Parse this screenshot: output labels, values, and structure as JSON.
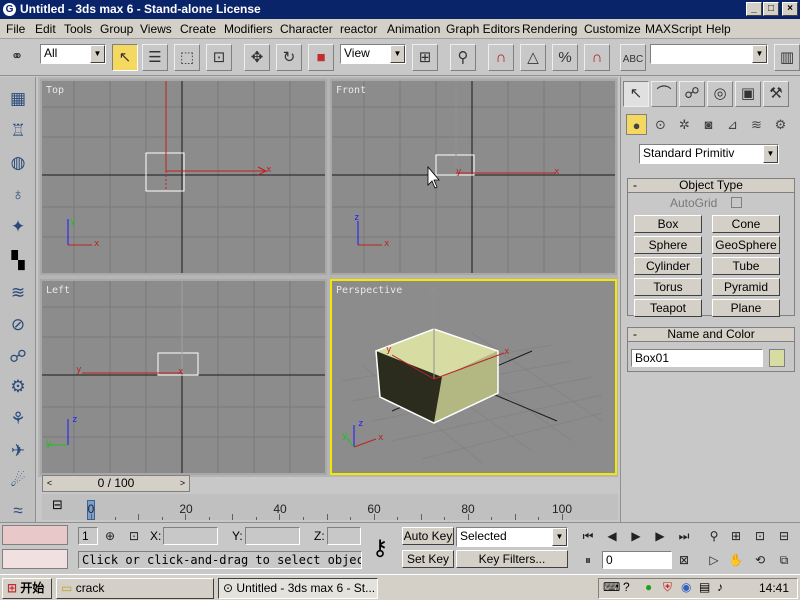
{
  "window": {
    "title": "Untitled - 3ds max 6 - Stand-alone License",
    "app_icon": "G",
    "controls": [
      "_",
      "□",
      "×"
    ]
  },
  "menu": [
    "File",
    "Edit",
    "Tools",
    "Group",
    "Views",
    "Create",
    "Modifiers",
    "Character",
    "reactor",
    "Animation",
    "Graph Editors",
    "Rendering",
    "Customize",
    "MAXScript",
    "Help"
  ],
  "toolbar": {
    "selection_filter": "All",
    "ref_coord": "View",
    "named_selection": ""
  },
  "viewports": [
    {
      "label": "Top"
    },
    {
      "label": "Front"
    },
    {
      "label": "Left"
    },
    {
      "label": "Perspective"
    }
  ],
  "axis_labels": {
    "x": "x",
    "y": "y",
    "z": "z"
  },
  "time_slider": {
    "value": "0 / 100",
    "left_arrow": "<",
    "right_arrow": ">"
  },
  "track_labels": [
    "0",
    "20",
    "40",
    "60",
    "80",
    "100"
  ],
  "command_panel": {
    "category_dropdown": "Standard Primitiv",
    "object_type": {
      "title": "Object Type",
      "collapse": "-",
      "autogrid": "AutoGrid",
      "buttons": [
        "Box",
        "Cone",
        "Sphere",
        "GeoSphere",
        "Cylinder",
        "Tube",
        "Torus",
        "Pyramid",
        "Teapot",
        "Plane"
      ]
    },
    "name_color": {
      "title": "Name and Color",
      "collapse": "-",
      "name_value": "Box01",
      "swatch_color": "#d7dca3"
    }
  },
  "status": {
    "selected_count": "1",
    "x_label": "X:",
    "y_label": "Y:",
    "z_label": "Z:",
    "prompt": "Click or click-and-drag to select objects",
    "auto_key": "Auto Key",
    "set_key": "Set Key",
    "key_mode": "Selected",
    "key_filters": "Key Filters...",
    "frame": "0"
  },
  "taskbar": {
    "start": "开始",
    "items": [
      "crack",
      "Untitled - 3ds max 6 - St..."
    ],
    "time": "14:41"
  }
}
